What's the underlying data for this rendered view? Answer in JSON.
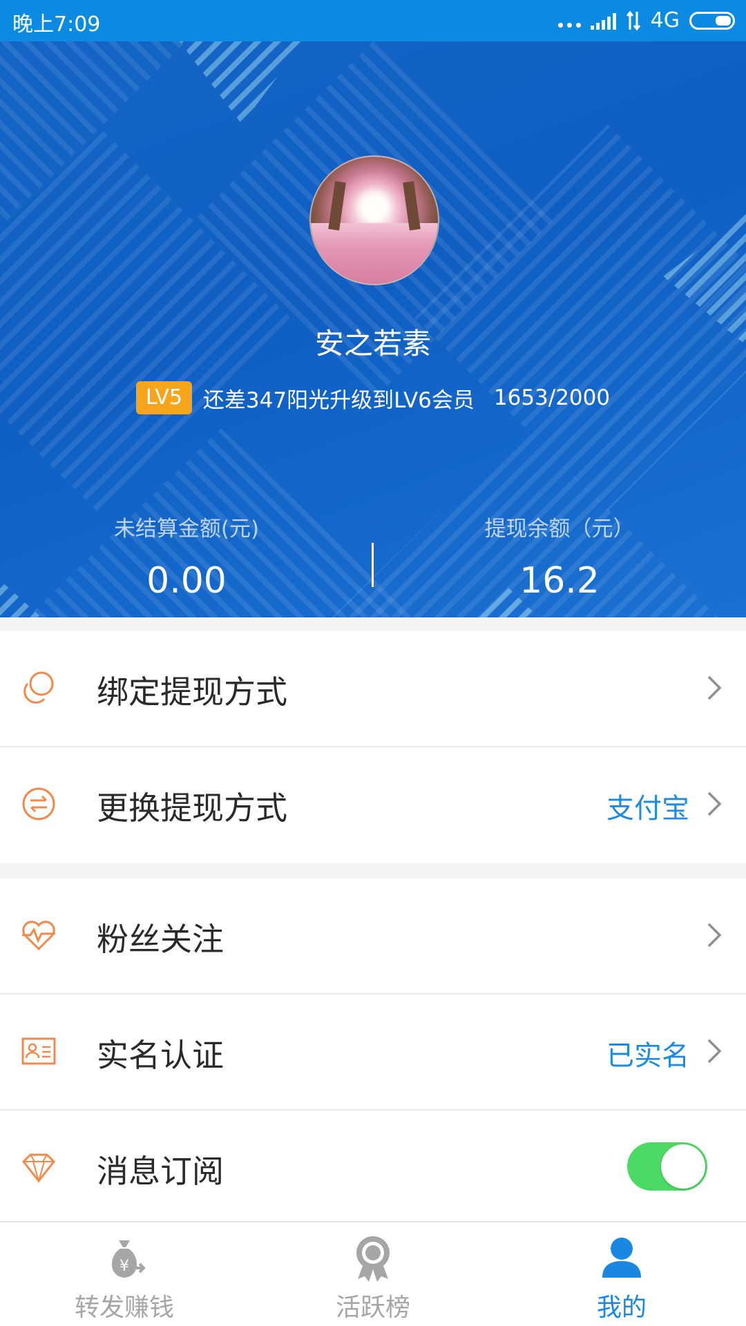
{
  "status_bar": {
    "time": "晚上7:09",
    "network": "4G"
  },
  "profile": {
    "username": "安之若素",
    "level_badge": "LV5",
    "level_hint": "还差347阳光升级到LV6会员",
    "level_progress": "1653/2000",
    "unsettled": {
      "label": "未结算金额(元)",
      "value": "0.00"
    },
    "withdrawable": {
      "label": "提现余额（元）",
      "value": "16.2"
    }
  },
  "menu": {
    "group1": [
      {
        "label": "绑定提现方式",
        "value": "",
        "icon": "bind-icon"
      },
      {
        "label": "更换提现方式",
        "value": "支付宝",
        "icon": "switch-icon"
      }
    ],
    "group2": [
      {
        "label": "粉丝关注",
        "value": "",
        "icon": "heart-pulse-icon"
      },
      {
        "label": "实名认证",
        "value": "已实名",
        "icon": "id-card-icon"
      },
      {
        "label": "消息订阅",
        "value": "",
        "icon": "diamond-icon",
        "toggle_on": true
      }
    ]
  },
  "bottom_nav": {
    "items": [
      {
        "label": "转发赚钱",
        "icon": "money-bag-icon",
        "active": false
      },
      {
        "label": "活跃榜",
        "icon": "medal-icon",
        "active": false
      },
      {
        "label": "我的",
        "icon": "person-icon",
        "active": true
      }
    ]
  },
  "colors": {
    "status_bar": "#0a8ae0",
    "header_blue": "#1565c6",
    "accent_orange": "#f7a51c",
    "icon_orange": "#f08a4b",
    "link_blue": "#1e8be0",
    "toggle_green": "#4cd964",
    "nav_active": "#1a87e0",
    "nav_inactive": "#a6a6a6"
  }
}
